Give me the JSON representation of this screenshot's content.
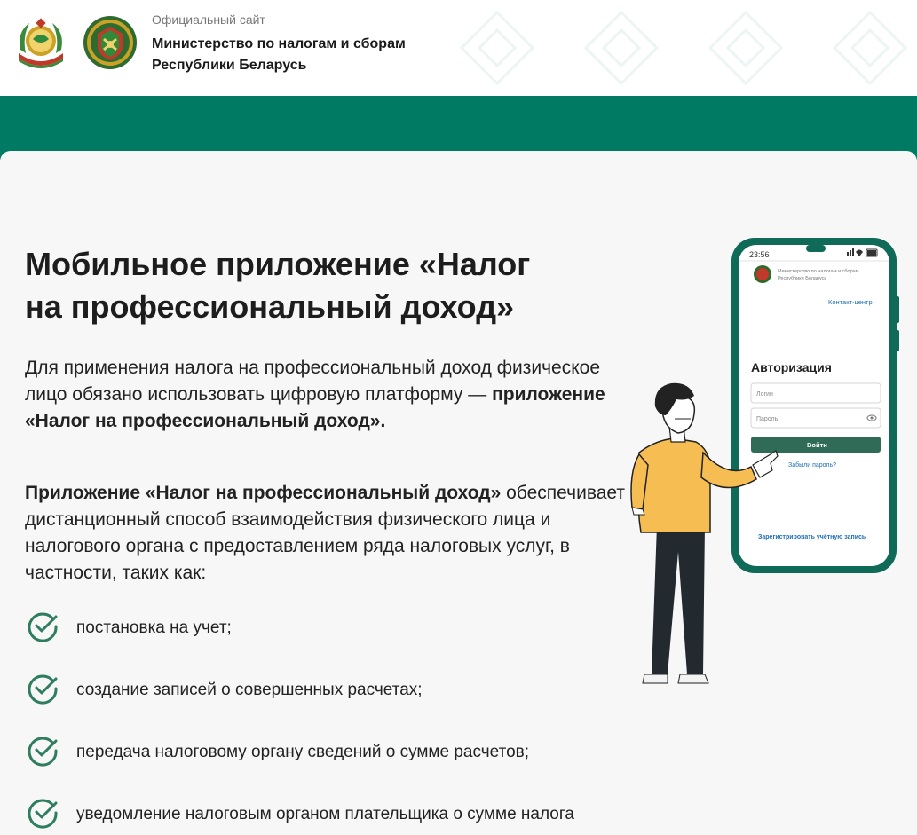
{
  "header": {
    "subtitle": "Официальный сайт",
    "title_line1": "Министерство по налогам и сборам",
    "title_line2": "Республики Беларусь"
  },
  "main": {
    "title_line1": "Мобильное приложение «Налог",
    "title_line2": "на профессиональный доход»",
    "para1_text": "Для применения налога на профессиональный доход физическое лицо обязано использовать цифровую платформу — ",
    "para1_bold": "приложение «Налог на профессиональный доход».",
    "para2_bold": "Приложение «Налог на профессиональный доход»",
    "para2_text": " обеспечивает дистанционный способ взаимодействия физического лица и  налогового органа с предоставлением ряда налоговых услуг, в  частности, таких как:",
    "list": [
      "постановка на учет;",
      "создание записей о совершенных расчетах;",
      "передача налоговому органу сведений о сумме расчетов;",
      "уведомление налоговым органом плательщика о сумме налога"
    ]
  },
  "phone": {
    "time": "23:56",
    "ministry_line1": "Министерство по налогам и сборам",
    "ministry_line2": "Республики Беларусь",
    "contact": "Контакт-центр",
    "auth_title": "Авторизация",
    "login_placeholder": "Логин",
    "password_placeholder": "Пароль",
    "login_button": "Войти",
    "forgot": "Забыли пароль?",
    "register": "Зарегистрировать учётную запись"
  },
  "colors": {
    "brand_green": "#017a64",
    "check_green": "#2e7d5e"
  }
}
